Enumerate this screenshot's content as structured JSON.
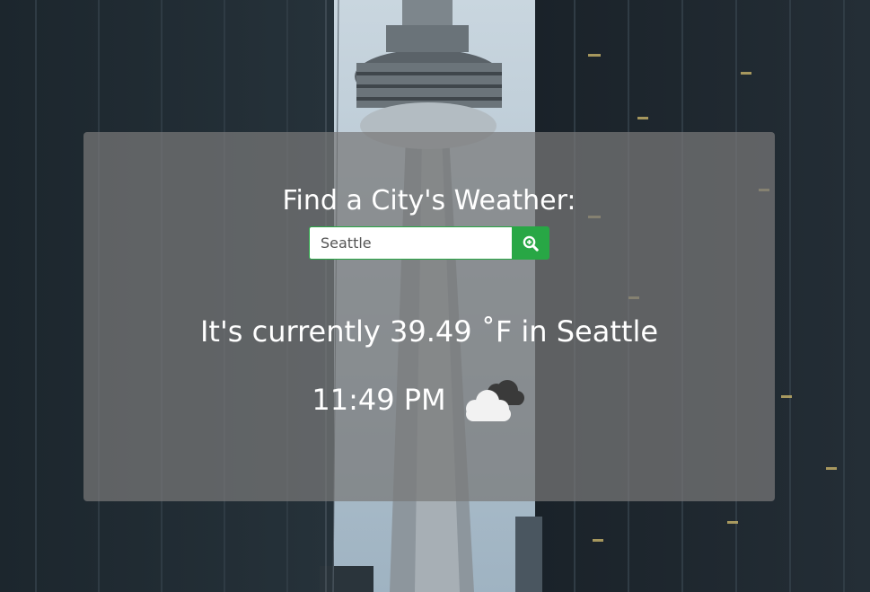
{
  "header": {
    "title": "Find a City's Weather:"
  },
  "search": {
    "value": "Seattle",
    "button_icon": "magnifier-zoom-icon",
    "accent_color": "#28a745"
  },
  "weather": {
    "temp_prefix": "It's currently",
    "temperature": "39.49",
    "unit": "˚F",
    "city_prefix": "in",
    "city": "Seattle",
    "time": "11:49 PM",
    "condition_icon": "cloudy-icon"
  },
  "background": {
    "icon": "cityscape-tower-photo"
  }
}
